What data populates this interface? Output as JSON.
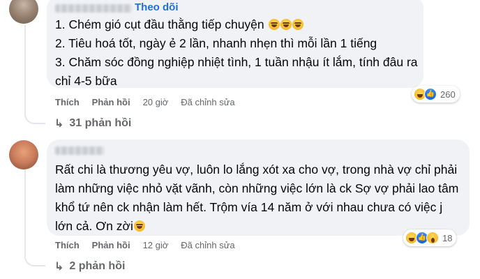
{
  "comments": [
    {
      "follow_label": "Theo dõi",
      "lines": [
        "1. Chém gió cụt đầu thằng tiếp chuyện",
        "2. Tiêu hoá tốt, ngày ẻ 2 lần, nhanh nhẹn thì mỗi lần 1 tiếng",
        "3. Chăm sóc đồng nghiệp nhiệt tình, 1 tuần nhậu ít lắm, tính đâu ra chỉ 4-5 bữa"
      ],
      "like_label": "Thích",
      "reply_label": "Phản hồi",
      "time": "20 giờ",
      "edited_label": "Đã chỉnh sửa",
      "reactions": {
        "icons": [
          "haha-icon",
          "like-icon"
        ],
        "count": "260"
      },
      "replies_label": "31 phản hồi"
    },
    {
      "text": "Rất chi là thương yêu vợ, luôn lo lắng xót xa cho vợ, trong nhà vợ chỉ phải làm những việc nhỏ vặt vãnh, còn những việc lớn là ck Sợ vợ phải lao tâm khổ tứ nên ck nhận làm hết. Trộm vía 14 năm ở với nhau chưa có việc j lớn cả. Ơn zời",
      "like_label": "Thích",
      "reply_label": "Phản hồi",
      "time": "12 giờ",
      "edited_label": "Đã chỉnh sửa",
      "reactions": {
        "icons": [
          "haha-icon",
          "like-icon",
          "wow-icon"
        ],
        "count": "18"
      },
      "replies_label": "2 phản hồi"
    }
  ],
  "colors": {
    "accent": "#216fdb",
    "bubble": "#f0f2f5",
    "muted": "#65676b"
  }
}
